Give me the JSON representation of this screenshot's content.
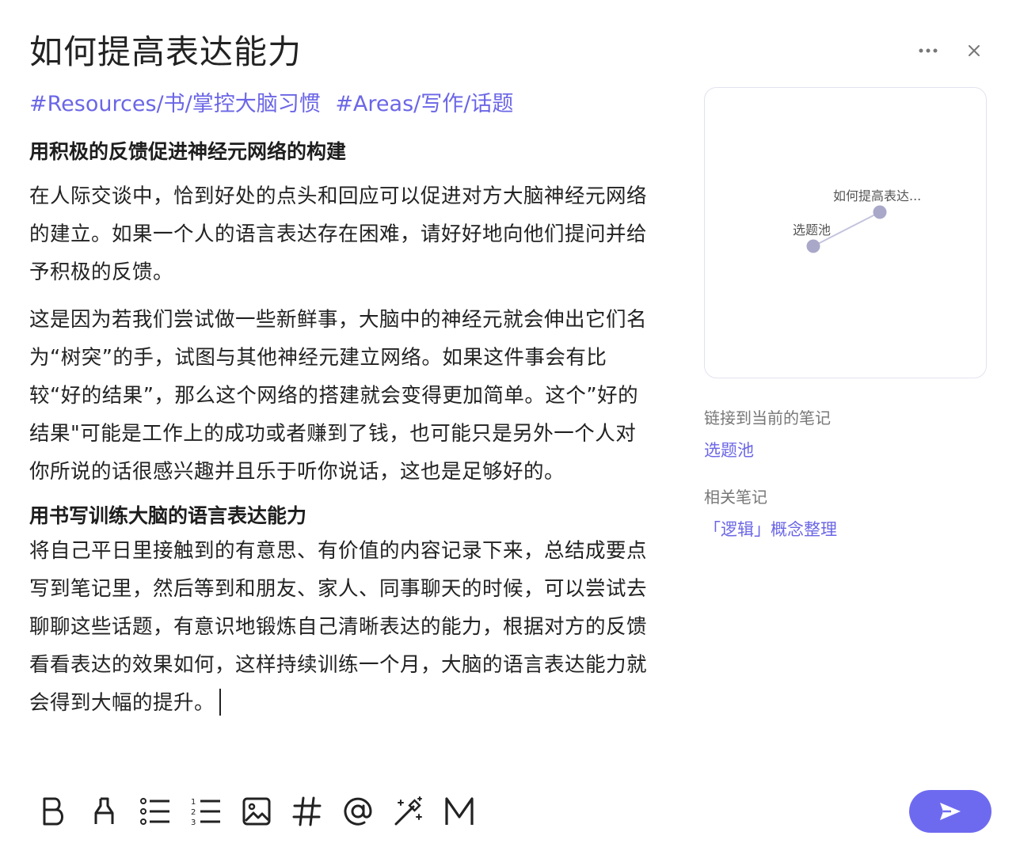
{
  "note": {
    "title": "如何提高表达能力",
    "tags": [
      "#Resources/书/掌控大脑习惯",
      "#Areas/写作/话题"
    ],
    "heading_1": "用积极的反馈促进神经元网络的构建",
    "para_1": "在人际交谈中，恰到好处的点头和回应可以促进对方大脑神经元网络的建立。如果一个人的语言表达存在困难，请好好地向他们提问并给予积极的反馈。",
    "para_2": "这是因为若我们尝试做一些新鲜事，大脑中的神经元就会伸出它们名为“树突”的手，试图与其他神经元建立网络。如果这件事会有比较“好的结果”，那么这个网络的搭建就会变得更加简单。这个”好的结果\"可能是工作上的成功或者赚到了钱，也可能只是另外一个人对你所说的话很感兴趣并且乐于听你说话，这也是足够好的。",
    "heading_2": "用书写训练大脑的语言表达能力",
    "para_3": "将自己平日里接触到的有意思、有价值的内容记录下来，总结成要点写到笔记里，然后等到和朋友、家人、同事聊天的时候，可以尝试去聊聊这些话题，有意识地锻炼自己清晰表达的能力，根据对方的反馈看看表达的效果如何，这样持续训练一个月，大脑的语言表达能力就会得到大幅的提升。"
  },
  "top_actions": {
    "more_icon": "more-horizontal-icon",
    "close_icon": "close-icon"
  },
  "graph": {
    "nodes": [
      {
        "label": "如何提高表达..."
      },
      {
        "label": "选题池"
      }
    ]
  },
  "sidebar": {
    "backlinks_label": "链接到当前的笔记",
    "backlinks": [
      "选题池"
    ],
    "related_label": "相关笔记",
    "related": [
      "「逻辑」概念整理"
    ]
  },
  "toolbar": {
    "icons": [
      "bold-icon",
      "highlighter-icon",
      "bullet-list-icon",
      "numbered-list-icon",
      "image-icon",
      "hashtag-icon",
      "mention-icon",
      "magic-wand-icon",
      "markdown-icon"
    ]
  },
  "colors": {
    "accent": "#6e6af0",
    "link": "#6b66e6",
    "node": "#a9a8c9"
  }
}
